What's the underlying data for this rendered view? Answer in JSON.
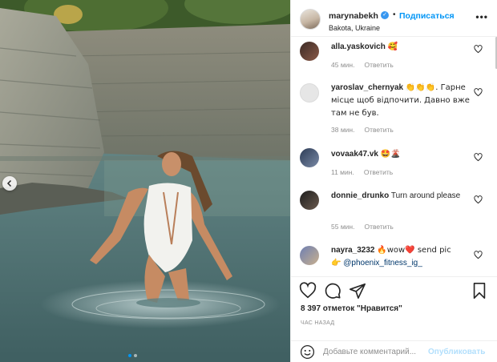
{
  "post": {
    "username": "marynabekh",
    "separator": "•",
    "follow_label": "Подписаться",
    "location": "Bakota, Ukraine",
    "more_label": "•••"
  },
  "comments": [
    {
      "username": "alla.yaskovich",
      "text": "🥰",
      "time": "45 мин.",
      "reply": "Ответить"
    },
    {
      "username": "yaroslav_chernyak",
      "text": "👏👏👏. Гарне місце щоб відпочити. Давно вже там не був.",
      "time": "38 мин.",
      "reply": "Ответить"
    },
    {
      "username": "vovaak47.vk",
      "text": "🤩🌋",
      "time": "11 мин.",
      "reply": "Ответить"
    },
    {
      "username": "donnie_drunko",
      "text": "Turn around please",
      "time": "55 мин.",
      "reply": "Ответить"
    },
    {
      "username": "nayra_3232",
      "text": "🔥wow❤️ send pic",
      "mention_prefix": "👉",
      "mention": "@phoenix_fitness_ig_",
      "time": "",
      "reply": ""
    }
  ],
  "likes_label": "8 397 отметок \"Нравится\"",
  "time_ago": "ЧАС НАЗАД",
  "comment_input": {
    "placeholder": "Добавьте комментарий...",
    "value": ""
  },
  "post_button": "Опубликовать",
  "colors": {
    "accent": "#0095f6",
    "verified": "#3897f0",
    "muted": "#8e8e8e"
  },
  "icons": [
    "verified-badge-icon",
    "more-options-icon",
    "heart-icon",
    "comment-icon",
    "share-icon",
    "bookmark-icon",
    "emoji-icon",
    "chevron-left-icon"
  ]
}
